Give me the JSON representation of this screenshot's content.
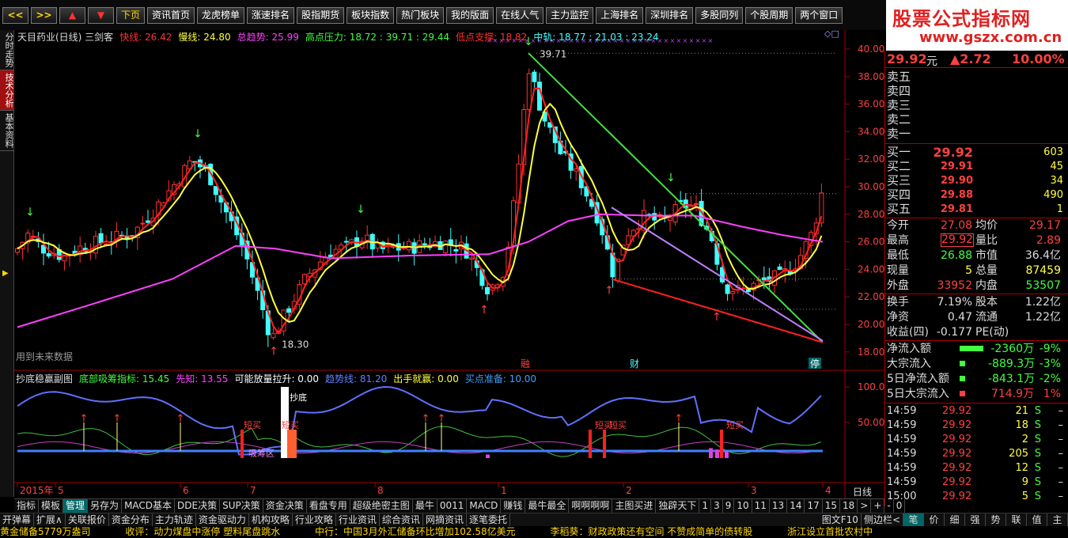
{
  "nav": {
    "buttons": [
      "资讯首页",
      "龙虎榜单",
      "涨速排名",
      "股指期货",
      "板块指数",
      "热门板块",
      "我的版面",
      "在线人气",
      "主力监控",
      "上海排名",
      "深圳排名",
      "多股同列",
      "个股周期",
      "两个窗口"
    ],
    "arrow_prev": "<<",
    "arrow_next": ">>",
    "up": "▲",
    "down": "▼",
    "page": "下页"
  },
  "brand": {
    "title": "股票公式指标网",
    "url": "www.gszx.com.cn"
  },
  "left_tabs": [
    "分时走势",
    "技术分析",
    "基本资料"
  ],
  "main_chart": {
    "header": [
      {
        "text": "天目药业(日线) 三剑客",
        "color": "#dddddd"
      },
      {
        "text": "快线: 26.42",
        "color": "#ff3030"
      },
      {
        "text": "慢线: 24.80",
        "color": "#ffff40"
      },
      {
        "text": "总趋势: 25.99",
        "color": "#ff40ff"
      },
      {
        "text": "高点压力: 18.72 : 39.71 : 29.44",
        "color": "#40ff40"
      },
      {
        "text": "低点支撑: 18.82",
        "color": "#ff3030"
      },
      {
        "text": "中轨: 18.77 : 21.03 : 23.24",
        "color": "#40ffff"
      }
    ],
    "price_axis": [
      "40.00",
      "38.00",
      "36.00",
      "34.00",
      "32.00",
      "30.00",
      "28.00",
      "26.00",
      "24.00",
      "22.00",
      "20.00",
      "18.00"
    ],
    "high_label": "39.71",
    "low_label": "18.30",
    "future_note": "用到未来数据",
    "events": [
      "融",
      "财",
      "停"
    ]
  },
  "sub_chart": {
    "header": [
      {
        "text": "抄底稳赢副图",
        "color": "#dddddd"
      },
      {
        "text": "底部吸筹指标: 15.45",
        "color": "#40ff40"
      },
      {
        "text": "先知: 13.55",
        "color": "#ff40ff"
      },
      {
        "text": "可能放量拉升: 0.00",
        "color": "#ffffff"
      },
      {
        "text": "趋势线: 81.20",
        "color": "#6080ff"
      },
      {
        "text": "出手就赢: 0.00",
        "color": "#ffff40"
      },
      {
        "text": "买点准备: 10.00",
        "color": "#40a0ff"
      }
    ],
    "axis": [
      "100.0",
      "50.00"
    ],
    "labels": [
      "短买",
      "短买",
      "抄底",
      "短买",
      "短买",
      "短买",
      "吸筹区"
    ]
  },
  "date_axis": {
    "labels": [
      "2015年",
      "5",
      "6",
      "7",
      "8",
      "1",
      "2",
      "3",
      "4"
    ],
    "period": "日线"
  },
  "quote": {
    "price": "29.92",
    "price_unit": "元",
    "change": "▲2.72",
    "pct": "10.00%",
    "sell": [
      {
        "label": "卖五"
      },
      {
        "label": "卖四"
      },
      {
        "label": "卖三"
      },
      {
        "label": "卖二"
      },
      {
        "label": "卖一"
      }
    ],
    "buy": [
      {
        "label": "买一",
        "price": "29.92",
        "vol": "603"
      },
      {
        "label": "买二",
        "price": "29.91",
        "vol": "45"
      },
      {
        "label": "买三",
        "price": "29.90",
        "vol": "34"
      },
      {
        "label": "买四",
        "price": "29.88",
        "vol": "490"
      },
      {
        "label": "买五",
        "price": "29.81",
        "vol": "1"
      }
    ],
    "stats": [
      {
        "l1": "今开",
        "v1": "27.08",
        "c1": "#ff4040",
        "l2": "均价",
        "v2": "29.17",
        "c2": "#ff4040"
      },
      {
        "l1": "最高",
        "v1": "29.92",
        "c1": "#ff4040",
        "l2": "量比",
        "v2": "2.89",
        "c2": "#ff4040",
        "box": true
      },
      {
        "l1": "最低",
        "v1": "26.88",
        "c1": "#40ff40",
        "l2": "市值",
        "v2": "36.4亿",
        "c2": "#dddddd"
      },
      {
        "l1": "现量",
        "v1": "5",
        "c1": "#ffff40",
        "l2": "总量",
        "v2": "87459",
        "c2": "#ffff40"
      },
      {
        "l1": "外盘",
        "v1": "33952",
        "c1": "#ff4040",
        "l2": "内盘",
        "v2": "53507",
        "c2": "#40ff40"
      }
    ],
    "stats2": [
      {
        "l1": "换手",
        "v1": "7.19%",
        "l2": "股本",
        "v2": "1.22亿"
      },
      {
        "l1": "净资",
        "v1": "0.47",
        "l2": "流通",
        "v2": "1.22亿"
      },
      {
        "l1": "收益(四)",
        "v1": "-0.177",
        "l2": "PE(动)",
        "v2": ""
      }
    ],
    "flows": [
      {
        "label": "净流入额",
        "value": "-2360万",
        "pct": "-9%",
        "color": "#40ff40"
      },
      {
        "label": "大宗流入",
        "value": "-889.3万",
        "pct": "-3%",
        "color": "#40ff40"
      },
      {
        "label": "5日净流入额",
        "value": "-843.1万",
        "pct": "-2%",
        "color": "#40ff40"
      },
      {
        "label": "5日大宗流入",
        "value": "714.9万",
        "pct": "1%",
        "color": "#ff4040"
      }
    ],
    "ticks": [
      {
        "time": "14:59",
        "price": "29.92",
        "vol": "21",
        "side": "S",
        "mark": "–"
      },
      {
        "time": "14:59",
        "price": "29.92",
        "vol": "18",
        "side": "S",
        "mark": "–"
      },
      {
        "time": "14:59",
        "price": "29.92",
        "vol": "2",
        "side": "S",
        "mark": "–"
      },
      {
        "time": "14:59",
        "price": "29.92",
        "vol": "205",
        "side": "S",
        "mark": "–"
      },
      {
        "time": "14:59",
        "price": "29.92",
        "vol": "12",
        "side": "S",
        "mark": "–"
      },
      {
        "time": "14:59",
        "price": "29.92",
        "vol": "9",
        "side": "S",
        "mark": "–"
      },
      {
        "time": "15:00",
        "price": "29.92",
        "vol": "5",
        "side": "S",
        "mark": "–"
      }
    ]
  },
  "bottom_tabs": [
    "指标",
    "模板",
    "管理",
    "另存为",
    "MACD基本",
    "DDE决策",
    "SUP决策",
    "资金决策",
    "看盘专用",
    "超级绝密主图",
    "最牛",
    "0011",
    "MACD",
    "赚钱",
    "最牛最全",
    "啊啊啊啊",
    "主图买进",
    "独辟天下",
    "1",
    "3",
    "9",
    "10",
    "11",
    "13",
    "14",
    "17",
    "15",
    "18"
  ],
  "bottom_tabs_right": [
    ">",
    "+",
    "-",
    "0"
  ],
  "bottom_tabs2": [
    "开弹幕",
    "扩展∧",
    "关联报价",
    "资金分布",
    "主力轨迹",
    "资金驱动力",
    "机构攻略",
    "行业攻略",
    "行业资讯",
    "综合资讯",
    "网摘资讯",
    "逐笔委托"
  ],
  "bottom_tabs2_right": [
    "图文F10",
    "侧边栏<",
    "笔",
    "价",
    "细",
    "强",
    "势",
    "联",
    "值",
    "主"
  ],
  "ticker": [
    "黄金储备5779万盎司",
    "收评：动力煤盘中涨停 塑料尾盘跳水",
    "中行：中国3月外汇储备环比增加102.58亿美元",
    "李稻葵：财政政策还有空间 不赞成简单的债转股",
    "浙江设立首批农村中"
  ]
}
